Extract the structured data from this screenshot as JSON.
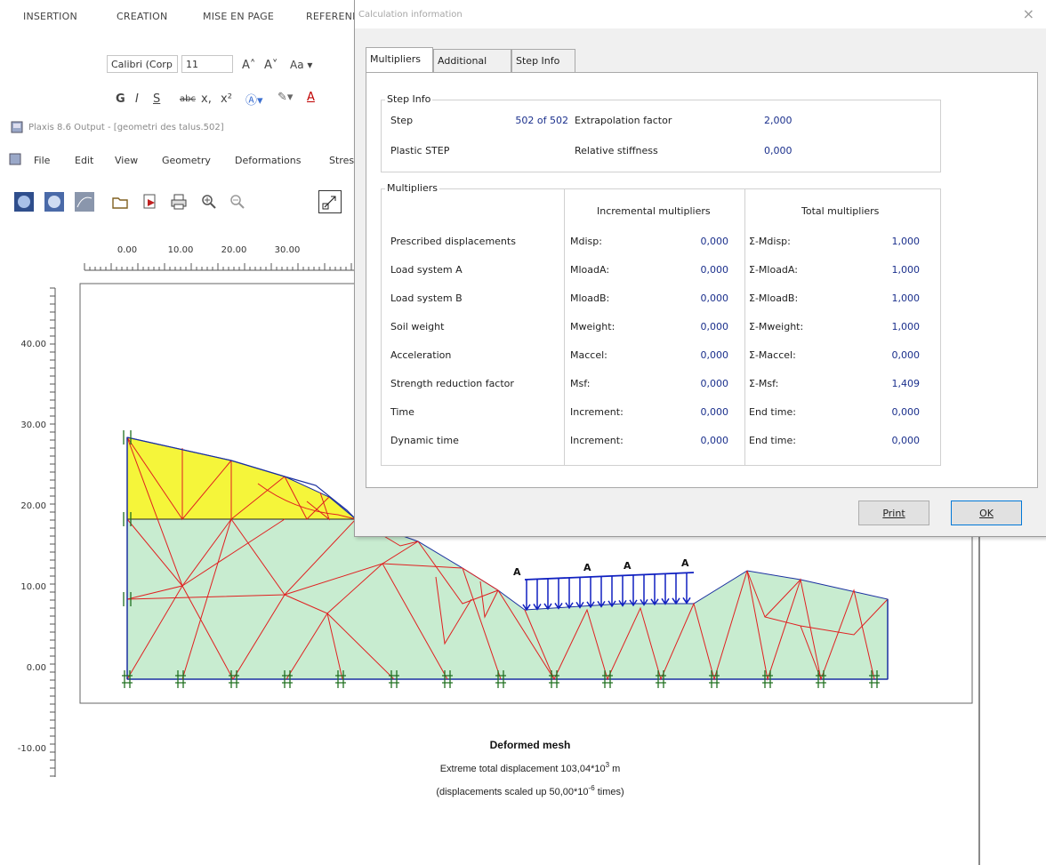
{
  "word_ribbon": {
    "tabs": [
      "INSERTION",
      "CREATION",
      "MISE EN PAGE",
      "REFERENI"
    ],
    "font_name": "Calibri (Corp",
    "font_size": "11",
    "format_buttons": [
      "G",
      "I",
      "S",
      "abc",
      "x,",
      "x²"
    ]
  },
  "plaxis": {
    "title": "Plaxis 8.6 Output - [geometri des talus.502]",
    "menu": [
      "File",
      "Edit",
      "View",
      "Geometry",
      "Deformations",
      "Stres"
    ],
    "x_ticks": [
      "0.00",
      "10.00",
      "20.00",
      "30.00"
    ],
    "y_ticks": [
      "40.00",
      "30.00",
      "20.00",
      "10.00",
      "0.00",
      "-10.00"
    ],
    "caption_title": "Deformed mesh",
    "caption_line1": "Extreme total displacement 103,04*10",
    "caption_line1_exp": "3",
    "caption_line1_unit": " m",
    "caption_line2a": "(displacements scaled up 50,00*10",
    "caption_line2_exp": "-6",
    "caption_line2b": " times)",
    "load_labels": [
      "A",
      "A",
      "A",
      "A"
    ],
    "colors": {
      "upper_soil": "#f5f53a",
      "lower_soil": "#c8ecd0",
      "mesh": "#e02020",
      "load": "#1020c0",
      "boundary": "#1a2fa0"
    }
  },
  "dialog": {
    "title": "Calculation information",
    "tabs": [
      "Multipliers",
      "Additional Info",
      "Step Info"
    ],
    "step_info_group": "Step Info",
    "step_label": "Step",
    "step_value": "502 of 502",
    "extrap_label": "Extrapolation factor",
    "extrap_value": "2,000",
    "plastic_label": "Plastic STEP",
    "rel_stiff_label": "Relative stiffness",
    "rel_stiff_value": "0,000",
    "multipliers_group": "Multipliers",
    "incremental_header": "Incremental multipliers",
    "total_header": "Total multipliers",
    "rows": [
      {
        "label": "Prescribed displacements",
        "inc_name": "Mdisp:",
        "inc_val": "0,000",
        "tot_name": "Σ-Mdisp:",
        "tot_val": "1,000"
      },
      {
        "label": "Load system A",
        "inc_name": "MloadA:",
        "inc_val": "0,000",
        "tot_name": "Σ-MloadA:",
        "tot_val": "1,000"
      },
      {
        "label": "Load system B",
        "inc_name": "MloadB:",
        "inc_val": "0,000",
        "tot_name": "Σ-MloadB:",
        "tot_val": "1,000"
      },
      {
        "label": "Soil weight",
        "inc_name": "Mweight:",
        "inc_val": "0,000",
        "tot_name": "Σ-Mweight:",
        "tot_val": "1,000"
      },
      {
        "label": "Acceleration",
        "inc_name": "Maccel:",
        "inc_val": "0,000",
        "tot_name": "Σ-Maccel:",
        "tot_val": "0,000"
      },
      {
        "label": "Strength reduction factor",
        "inc_name": "Msf:",
        "inc_val": "0,000",
        "tot_name": "Σ-Msf:",
        "tot_val": "1,409"
      },
      {
        "label": "Time",
        "inc_name": "Increment:",
        "inc_val": "0,000",
        "tot_name": "End time:",
        "tot_val": "0,000"
      },
      {
        "label": "Dynamic time",
        "inc_name": "Increment:",
        "inc_val": "0,000",
        "tot_name": "End time:",
        "tot_val": "0,000"
      }
    ],
    "print_label": "Print",
    "ok_label": "OK",
    "close_symbol": "×"
  }
}
